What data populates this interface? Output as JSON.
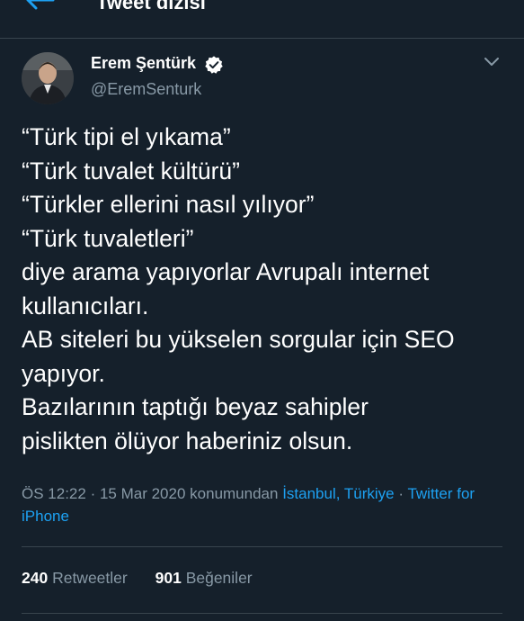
{
  "header": {
    "title": "Tweet dizisi",
    "back_icon": "arrow-left-icon"
  },
  "tweet": {
    "author": {
      "display_name": "Erem Şentürk",
      "handle": "@EremSenturk",
      "verified_icon": "verified-badge-icon"
    },
    "menu_icon": "chevron-down-icon",
    "text_lines": [
      "“Türk tipi el yıkama”",
      "“Türk tuvalet kültürü”",
      "“Türkler ellerini nasıl yılıyor”",
      "“Türk tuvaletleri”",
      "diye arama yapıyorlar Avrupalı internet",
      "kullanıcıları.",
      "AB siteleri bu yükselen sorgular için SEO",
      "yapıyor.",
      "Bazılarının taptığı beyaz sahipler",
      "pislikten ölüyor haberiniz olsun."
    ],
    "meta": {
      "time": "ÖS 12:22",
      "date": "15 Mar 2020",
      "location_prefix": "konumundan",
      "location": "İstanbul, Türkiye",
      "source": "Twitter for iPhone"
    },
    "stats": {
      "retweets_count": "240",
      "retweets_label": "Retweetler",
      "likes_count": "901",
      "likes_label": "Beğeniler"
    }
  },
  "colors": {
    "background": "#15202b",
    "divider": "#38444d",
    "secondary_text": "#8899a6",
    "link": "#1da1f2"
  }
}
